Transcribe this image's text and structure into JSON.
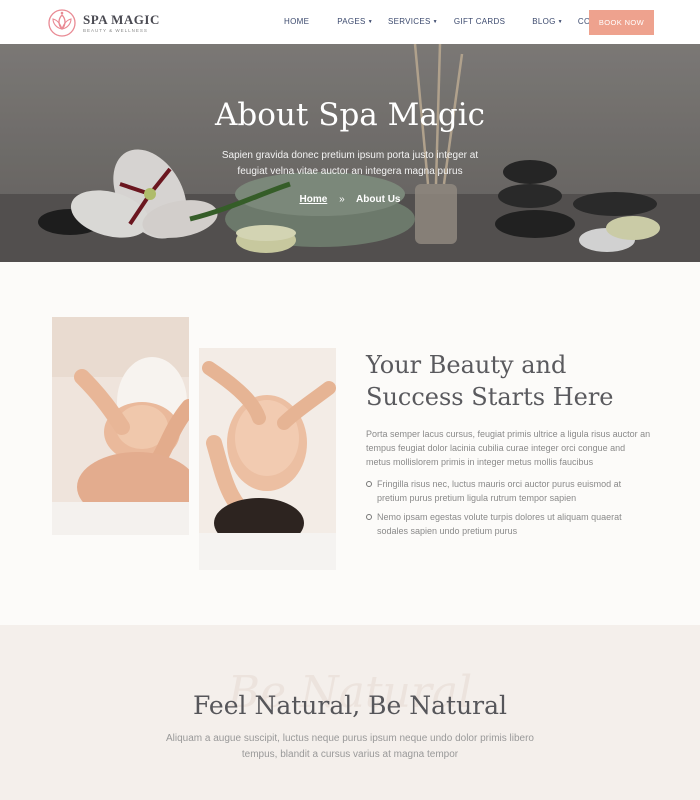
{
  "brand": {
    "name": "SPA MAGIC",
    "tagline": "BEAUTY & WELLNESS",
    "accent_color": "#eea28e"
  },
  "nav": {
    "items": [
      {
        "label": "HOME",
        "dropdown": false
      },
      {
        "label": "PAGES",
        "dropdown": true
      },
      {
        "label": "SERVICES",
        "dropdown": true
      },
      {
        "label": "GIFT CARDS",
        "dropdown": false
      },
      {
        "label": "BLOG",
        "dropdown": true
      },
      {
        "label": "CONTACTS",
        "dropdown": false
      }
    ],
    "cta_label": "BOOK NOW"
  },
  "hero": {
    "title": "About Spa Magic",
    "subtitle": "Sapien gravida donec pretium ipsum porta justo integer at feugiat velna vitae auctor an integera magna purus",
    "breadcrumb": {
      "home": "Home",
      "separator": "»",
      "current": "About Us"
    }
  },
  "about": {
    "title": "Your Beauty and Success Starts Here",
    "paragraph": "Porta semper lacus cursus, feugiat primis ultrice a ligula risus auctor an tempus feugiat dolor lacinia cubilia curae integer orci congue and metus mollislorem primis in integer metus mollis faucibus",
    "list": [
      "Fringilla risus nec, luctus mauris orci auctor purus euismod at pretium purus pretium ligula rutrum tempor sapien",
      "Nemo ipsam egestas volute turpis dolores ut aliquam quaerat sodales sapien undo pretium purus"
    ]
  },
  "natural": {
    "script_text": "Be Natural",
    "title": "Feel Natural, Be Natural",
    "subtitle": "Aliquam a augue suscipit, luctus neque purus ipsum neque undo dolor primis libero tempus, blandit a cursus varius at magna tempor"
  }
}
